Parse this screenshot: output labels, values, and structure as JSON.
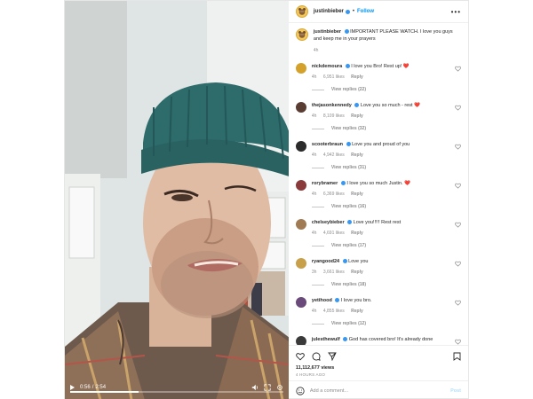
{
  "video": {
    "current_time": "0:56",
    "separator": "/",
    "duration": "2:54",
    "progress_fraction": 0.32
  },
  "header": {
    "username": "justinbieber",
    "dot": "•",
    "follow_label": "Follow",
    "more_label": "•••"
  },
  "caption": {
    "username": "justinbieber",
    "text": "IMPORTANT PLEASE WATCH. I love you guys and keep me in your prayers",
    "age": "4h"
  },
  "comments": [
    {
      "user": "nickdemoura",
      "text": "I love you Bro! Rest up!",
      "emoji": "❤️",
      "age": "4h",
      "likes": "6,951 likes",
      "reply": "Reply",
      "view_replies": "View replies (22)",
      "avatar_color": "#d4a12a"
    },
    {
      "user": "thejasonkennedy",
      "text": "Love you so much - rest",
      "emoji": "❤️",
      "age": "4h",
      "likes": "8,109 likes",
      "reply": "Reply",
      "view_replies": "View replies (32)",
      "avatar_color": "#5a3d32"
    },
    {
      "user": "scooterbraun",
      "text": "Love you and proud of you",
      "emoji": "",
      "age": "4h",
      "likes": "4,942 likes",
      "reply": "Reply",
      "view_replies": "View replies (31)",
      "avatar_color": "#2b2b2b"
    },
    {
      "user": "rorybramer",
      "text": "I love you so much Justin.",
      "emoji": "❤️",
      "age": "4h",
      "likes": "6,369 likes",
      "reply": "Reply",
      "view_replies": "View replies (16)",
      "avatar_color": "#8a3a3a"
    },
    {
      "user": "chelseybieber",
      "text": "Love you!!!!! Rest rest",
      "emoji": "",
      "age": "4h",
      "likes": "4,691 likes",
      "reply": "Reply",
      "view_replies": "View replies (17)",
      "avatar_color": "#a07a52"
    },
    {
      "user": "ryangood24",
      "text": "Love you",
      "emoji": "",
      "age": "3h",
      "likes": "3,661 likes",
      "reply": "Reply",
      "view_replies": "View replies (18)",
      "avatar_color": "#c9a04a"
    },
    {
      "user": "yetihood",
      "text": "I love you bro.",
      "emoji": "",
      "age": "4h",
      "likes": "4,855 likes",
      "reply": "Reply",
      "view_replies": "View replies (12)",
      "avatar_color": "#6a4a7a"
    },
    {
      "user": "julesthewulf",
      "text": "God has covered bro! It's already done",
      "emoji": "",
      "age": "",
      "likes": "",
      "reply": "",
      "view_replies": "",
      "avatar_color": "#3a3a3a"
    }
  ],
  "stats": {
    "views": "11,112,677 views",
    "posted": "4 HOURS AGO"
  },
  "add_comment": {
    "placeholder": "Add a comment...",
    "post_label": "Post"
  },
  "colors": {
    "accent": "#0095f6",
    "verified": "#3897f0",
    "heart": "#e0245e",
    "beanie": "#2e6b6b"
  },
  "icons": [
    "play-icon",
    "volume-icon",
    "fullscreen-icon",
    "heart-icon",
    "comment-icon",
    "share-icon",
    "bookmark-icon",
    "smiley-icon",
    "more-icon",
    "verified-icon"
  ]
}
